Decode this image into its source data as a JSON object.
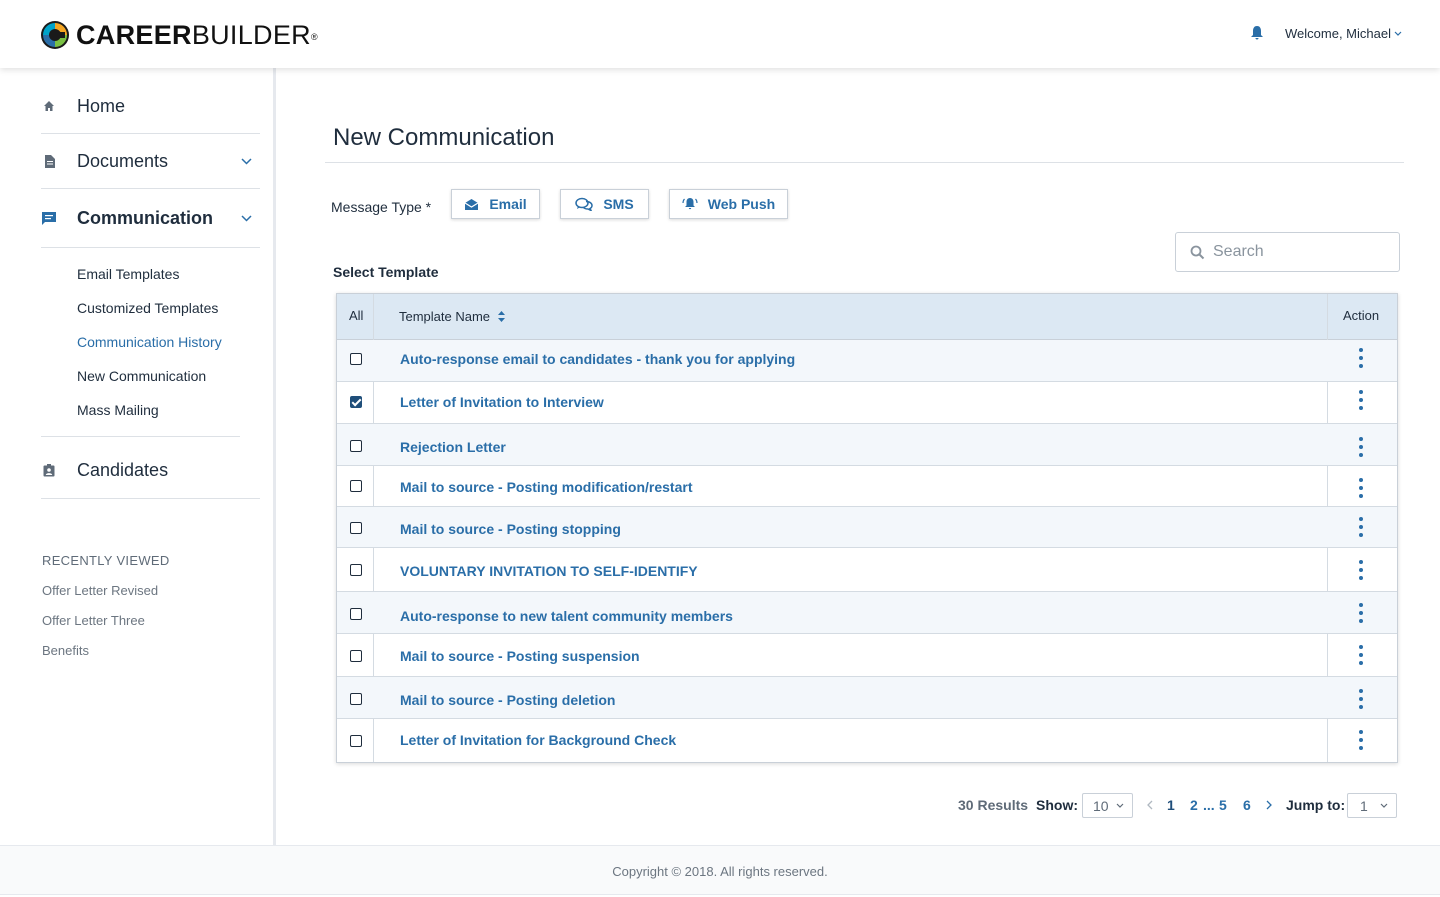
{
  "brand": {
    "name_bold": "CAREER",
    "name_light": "BUILDER",
    "mark": "®"
  },
  "header": {
    "welcome": "Welcome, Michael",
    "bell_icon": "bell-icon"
  },
  "sidebar": {
    "items": [
      {
        "label": "Home",
        "icon": "home-icon"
      },
      {
        "label": "Documents",
        "icon": "document-icon"
      },
      {
        "label": "Communication",
        "icon": "chat-icon"
      },
      {
        "label": "Candidates",
        "icon": "candidate-badge-icon"
      }
    ],
    "sub_items": [
      "Email Templates",
      "Customized Templates",
      "Communication History",
      "New Communication",
      "Mass Mailing"
    ],
    "recent_title": "RECENTLY VIEWED",
    "recent_items": [
      "Offer Letter Revised",
      "Offer Letter Three",
      "Benefits"
    ]
  },
  "main": {
    "title": "New Communication",
    "message_type_label": "Message Type *",
    "message_types": [
      {
        "label": "Email",
        "icon": "envelope-icon"
      },
      {
        "label": "SMS",
        "icon": "chat-bubbles-icon"
      },
      {
        "label": "Web Push",
        "icon": "bell-icon"
      }
    ],
    "select_template_label": "Select Template",
    "search_placeholder": "Search"
  },
  "table": {
    "headers": {
      "all": "All",
      "name": "Template Name",
      "action": "Action"
    },
    "rows": [
      {
        "name": "Auto-response email to candidates - thank you for applying",
        "checked": false
      },
      {
        "name": "Letter of Invitation to Interview",
        "checked": true
      },
      {
        "name": "Rejection Letter",
        "checked": false
      },
      {
        "name": "Mail to source - Posting modification/restart",
        "checked": false
      },
      {
        "name": "Mail to source - Posting stopping",
        "checked": false
      },
      {
        "name": "VOLUNTARY INVITATION TO SELF-IDENTIFY",
        "checked": false
      },
      {
        "name": "Auto-response to new talent community members",
        "checked": false
      },
      {
        "name": "Mail to source - Posting suspension",
        "checked": false
      },
      {
        "name": "Mail to source - Posting deletion",
        "checked": false
      },
      {
        "name": "Letter of Invitation for Background Check",
        "checked": false
      }
    ]
  },
  "pagination": {
    "results": "30 Results",
    "show_label": "Show:",
    "show_value": "10",
    "pages": [
      "1",
      "2",
      "5",
      "6"
    ],
    "ellipsis": "...",
    "current_page": "1",
    "jump_label": "Jump to:",
    "jump_value": "1"
  },
  "footer": {
    "copyright": "Copyright © 2018. All rights reserved."
  },
  "colors": {
    "accent": "#2a6ea8",
    "header_row": "#dce8f3",
    "text": "#1f2d3d"
  }
}
